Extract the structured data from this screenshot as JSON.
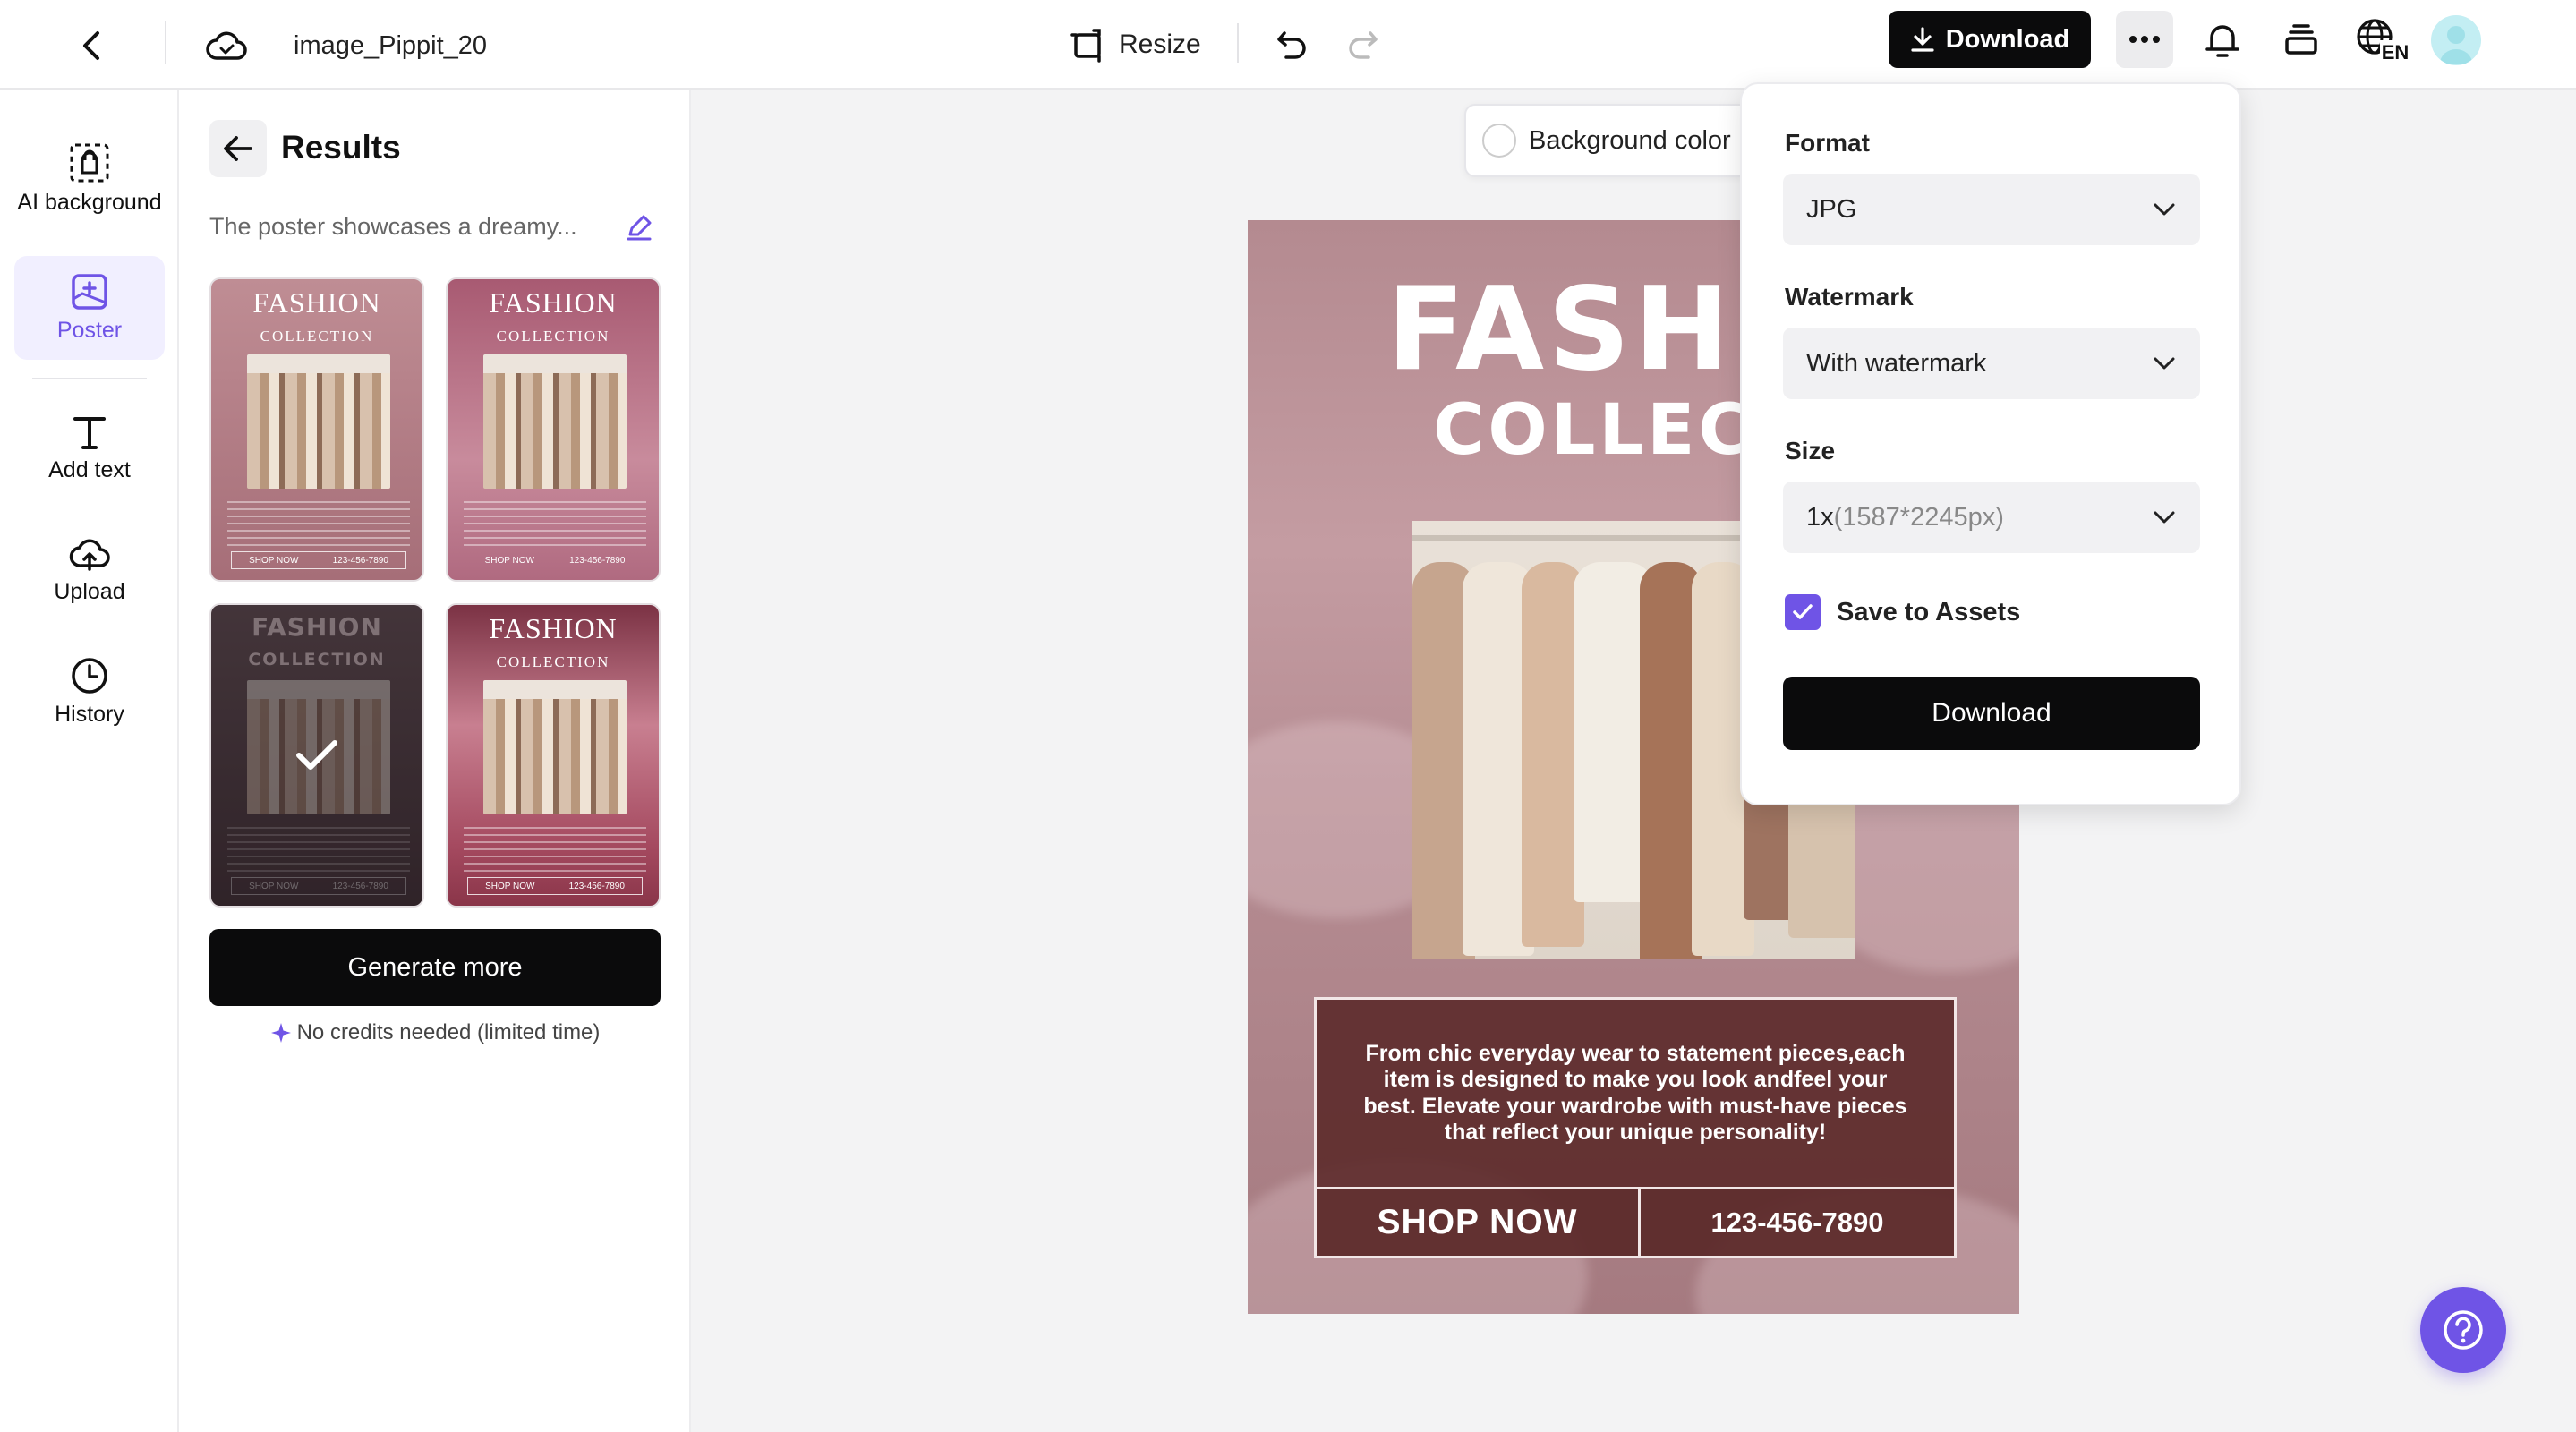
{
  "header": {
    "filename": "image_Pippit_20",
    "resize_label": "Resize",
    "download_label": "Download",
    "lang": "EN"
  },
  "rail": {
    "items": [
      {
        "label": "AI background",
        "icon": "ai-background-icon"
      },
      {
        "label": "Poster",
        "icon": "poster-icon",
        "active": true
      },
      {
        "label": "Add text",
        "icon": "text-icon"
      },
      {
        "label": "Upload",
        "icon": "upload-cloud-icon"
      },
      {
        "label": "History",
        "icon": "clock-icon"
      }
    ]
  },
  "results": {
    "title": "Results",
    "description": "The poster showcases a dreamy...",
    "thumbnails": [
      {
        "title": "FASHION",
        "subtitle": "COLLECTION",
        "footer_left": "SHOP NOW",
        "footer_right": "123-456-7890"
      },
      {
        "title": "FASHION",
        "subtitle": "COLLECTION",
        "footer_left": "SHOP NOW",
        "footer_right": "123-456-7890"
      },
      {
        "title": "FASHION",
        "subtitle": "COLLECTION",
        "footer_left": "SHOP NOW",
        "footer_right": "123-456-7890",
        "selected": true
      },
      {
        "title": "FASHION",
        "subtitle": "COLLECTION",
        "footer_left": "SHOP NOW",
        "footer_right": "123-456-7890"
      }
    ],
    "generate_more_label": "Generate more",
    "no_credits_label": "No credits needed (limited time)"
  },
  "canvas": {
    "background_color_label": "Background color",
    "poster": {
      "title_line1": "FASHIO",
      "title_line2": "COLLECTI",
      "body": "From chic everyday wear to statement pieces,each item is designed to make you look andfeel your best. Elevate your wardrobe with must-have pieces that reflect your unique personality!",
      "cta": "SHOP NOW",
      "phone": "123-456-7890"
    }
  },
  "download_panel": {
    "format_label": "Format",
    "format_value": "JPG",
    "watermark_label": "Watermark",
    "watermark_value": "With watermark",
    "size_label": "Size",
    "size_value": "1x",
    "size_detail": "(1587*2245px)",
    "save_to_assets_label": "Save to Assets",
    "save_to_assets_checked": true,
    "download_button_label": "Download"
  },
  "colors": {
    "accent": "#6f54e6",
    "primary_button": "#0b0b0c",
    "poster_box": "#5a2828"
  }
}
